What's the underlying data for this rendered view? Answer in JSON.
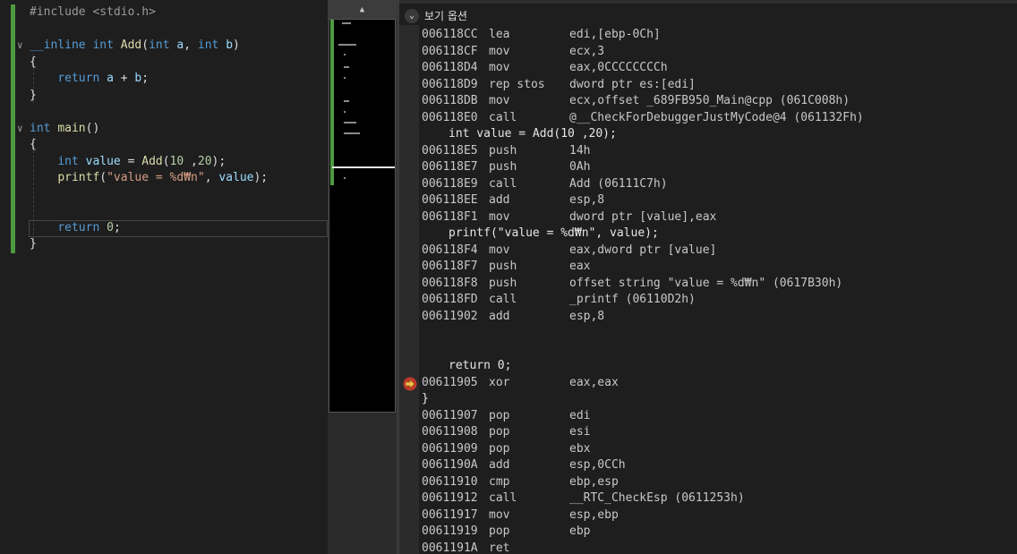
{
  "editor": {
    "lines": [
      {
        "t": "#include <stdio.h>"
      },
      {
        "t": ""
      },
      {
        "t": "__inline int Add(int a, int b)"
      },
      {
        "t": "{"
      },
      {
        "t": "    return a + b;"
      },
      {
        "t": "}"
      },
      {
        "t": ""
      },
      {
        "t": "int main()"
      },
      {
        "t": "{"
      },
      {
        "t": "    int value = Add(10 ,20);"
      },
      {
        "t": "    printf(\"value = %d₩n\", value);"
      },
      {
        "t": ""
      },
      {
        "t": ""
      },
      {
        "t": "    return 0;"
      },
      {
        "t": "}"
      }
    ]
  },
  "minimap": {
    "scroll_up_glyph": "▲"
  },
  "disasm": {
    "header_label": "보기 옵션",
    "rows": [
      {
        "kind": "asm",
        "addr": "006118CC",
        "mn": "lea",
        "op": "edi,[ebp-0Ch]"
      },
      {
        "kind": "asm",
        "addr": "006118CF",
        "mn": "mov",
        "op": "ecx,3"
      },
      {
        "kind": "asm",
        "addr": "006118D4",
        "mn": "mov",
        "op": "eax,0CCCCCCCCh"
      },
      {
        "kind": "asm",
        "addr": "006118D9",
        "mn": "rep stos",
        "op": "dword ptr es:[edi]"
      },
      {
        "kind": "asm",
        "addr": "006118DB",
        "mn": "mov",
        "op": "ecx,offset _689FB950_Main@cpp (061C008h)"
      },
      {
        "kind": "asm",
        "addr": "006118E0",
        "mn": "call",
        "op": "@__CheckForDebuggerJustMyCode@4 (061132Fh)"
      },
      {
        "kind": "src",
        "text": "int value = Add(10 ,20);"
      },
      {
        "kind": "asm",
        "addr": "006118E5",
        "mn": "push",
        "op": "14h"
      },
      {
        "kind": "asm",
        "addr": "006118E7",
        "mn": "push",
        "op": "0Ah"
      },
      {
        "kind": "asm",
        "addr": "006118E9",
        "mn": "call",
        "op": "Add (06111C7h)"
      },
      {
        "kind": "asm",
        "addr": "006118EE",
        "mn": "add",
        "op": "esp,8"
      },
      {
        "kind": "asm",
        "addr": "006118F1",
        "mn": "mov",
        "op": "dword ptr [value],eax"
      },
      {
        "kind": "src",
        "text": "printf(\"value = %d₩n\", value);"
      },
      {
        "kind": "asm",
        "addr": "006118F4",
        "mn": "mov",
        "op": "eax,dword ptr [value]"
      },
      {
        "kind": "asm",
        "addr": "006118F7",
        "mn": "push",
        "op": "eax"
      },
      {
        "kind": "asm",
        "addr": "006118F8",
        "mn": "push",
        "op": "offset string \"value = %d₩n\" (0617B30h)"
      },
      {
        "kind": "asm",
        "addr": "006118FD",
        "mn": "call",
        "op": "_printf (06110D2h)"
      },
      {
        "kind": "asm",
        "addr": "00611902",
        "mn": "add",
        "op": "esp,8"
      },
      {
        "kind": "blank"
      },
      {
        "kind": "blank"
      },
      {
        "kind": "src",
        "text": "return 0;"
      },
      {
        "kind": "asm",
        "addr": "00611905",
        "mn": "xor",
        "op": "eax,eax",
        "current": true
      },
      {
        "kind": "brace",
        "text": "}"
      },
      {
        "kind": "asm",
        "addr": "00611907",
        "mn": "pop",
        "op": "edi"
      },
      {
        "kind": "asm",
        "addr": "00611908",
        "mn": "pop",
        "op": "esi"
      },
      {
        "kind": "asm",
        "addr": "00611909",
        "mn": "pop",
        "op": "ebx"
      },
      {
        "kind": "asm",
        "addr": "0061190A",
        "mn": "add",
        "op": "esp,0CCh"
      },
      {
        "kind": "asm",
        "addr": "00611910",
        "mn": "cmp",
        "op": "ebp,esp"
      },
      {
        "kind": "asm",
        "addr": "00611912",
        "mn": "call",
        "op": "__RTC_CheckEsp (0611253h)"
      },
      {
        "kind": "asm",
        "addr": "00611917",
        "mn": "mov",
        "op": "esp,ebp"
      },
      {
        "kind": "asm",
        "addr": "00611919",
        "mn": "pop",
        "op": "ebp"
      },
      {
        "kind": "asm",
        "addr": "0061191A",
        "mn": "ret",
        "op": ""
      }
    ]
  },
  "colors": {
    "green_change_bar": "#4e9a40",
    "ip_arrow": "#e8a23a"
  }
}
